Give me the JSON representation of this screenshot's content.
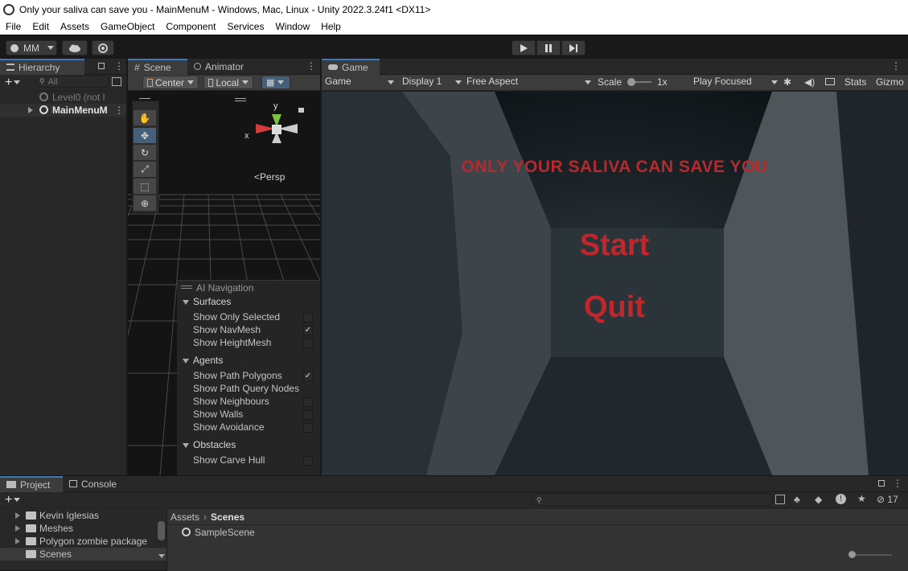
{
  "window": {
    "title": "Only your saliva can save you - MainMenuM - Windows, Mac, Linux - Unity 2022.3.24f1 <DX11>"
  },
  "menu": [
    "File",
    "Edit",
    "Assets",
    "GameObject",
    "Component",
    "Services",
    "Window",
    "Help"
  ],
  "toolbar": {
    "account": "MM"
  },
  "hierarchy": {
    "tab": "Hierarchy",
    "search_placeholder": "All",
    "items": [
      {
        "label": "Level0 (not l"
      },
      {
        "label": "MainMenuM"
      }
    ]
  },
  "scene": {
    "tabs": [
      "Scene",
      "Animator"
    ],
    "pivot": "Center",
    "space": "Local",
    "axis_y": "y",
    "axis_x": "x",
    "persp": "Persp"
  },
  "ai_nav": {
    "title": "AI Navigation",
    "sections": [
      {
        "name": "Surfaces",
        "items": [
          {
            "label": "Show Only Selected",
            "checked": false
          },
          {
            "label": "Show NavMesh",
            "checked": true
          },
          {
            "label": "Show HeightMesh",
            "checked": false
          }
        ]
      },
      {
        "name": "Agents",
        "items": [
          {
            "label": "Show Path Polygons",
            "checked": true
          },
          {
            "label": "Show Path Query Nodes",
            "checked": false
          },
          {
            "label": "Show Neighbours",
            "checked": false
          },
          {
            "label": "Show Walls",
            "checked": false
          },
          {
            "label": "Show Avoidance",
            "checked": false
          }
        ]
      },
      {
        "name": "Obstacles",
        "items": [
          {
            "label": "Show Carve Hull",
            "checked": false
          }
        ]
      }
    ]
  },
  "game": {
    "tab": "Game",
    "mode": "Game",
    "display": "Display 1",
    "aspect": "Free Aspect",
    "scale_label": "Scale",
    "scale_value": "1x",
    "play_mode": "Play Focused",
    "stats": "Stats",
    "gizmos": "Gizmo",
    "headline": "ONLY YOUR SALIVA CAN SAVE YOU",
    "start": "Start",
    "quit": "Quit",
    "accent": "#c0272d"
  },
  "project": {
    "tabs": [
      "Project",
      "Console"
    ],
    "folders": [
      "Kevin Iglesias",
      "Meshes",
      "Polygon zombie package",
      "Scenes"
    ],
    "breadcrumb": [
      "Assets",
      "Scenes"
    ],
    "assets": [
      "SampleScene"
    ],
    "hidden_count": "17"
  }
}
